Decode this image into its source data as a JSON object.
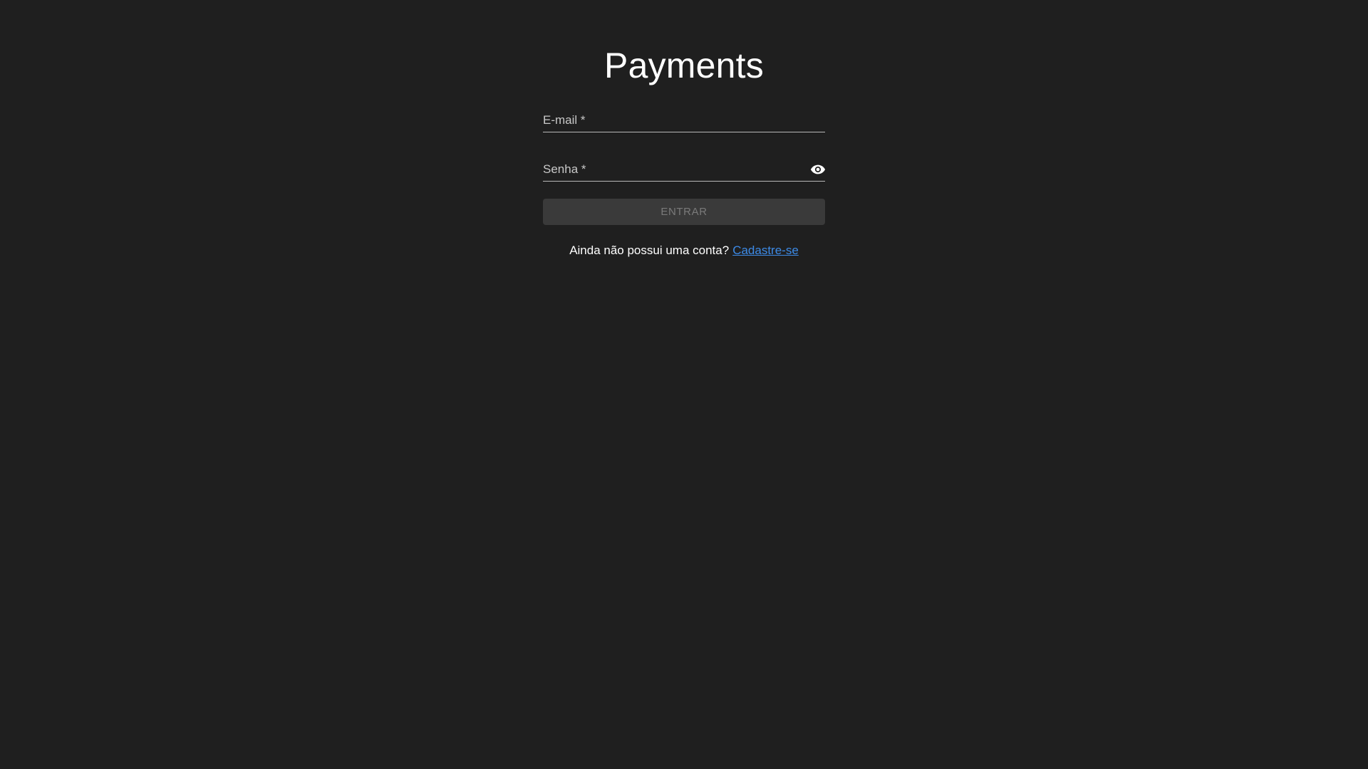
{
  "header": {
    "title": "Payments"
  },
  "form": {
    "email_label": "E-mail *",
    "email_value": "",
    "password_label": "Senha *",
    "password_value": "",
    "password_toggle_icon": "eye-icon",
    "submit_label": "ENTRAR"
  },
  "signup": {
    "prompt": "Ainda não possui uma conta?",
    "link_label": "Cadastre-se"
  },
  "colors": {
    "background": "#1f1f1f",
    "link": "#3d8be8",
    "button_disabled_bg": "#3a3a3a",
    "button_disabled_text": "#7a7a7a"
  }
}
